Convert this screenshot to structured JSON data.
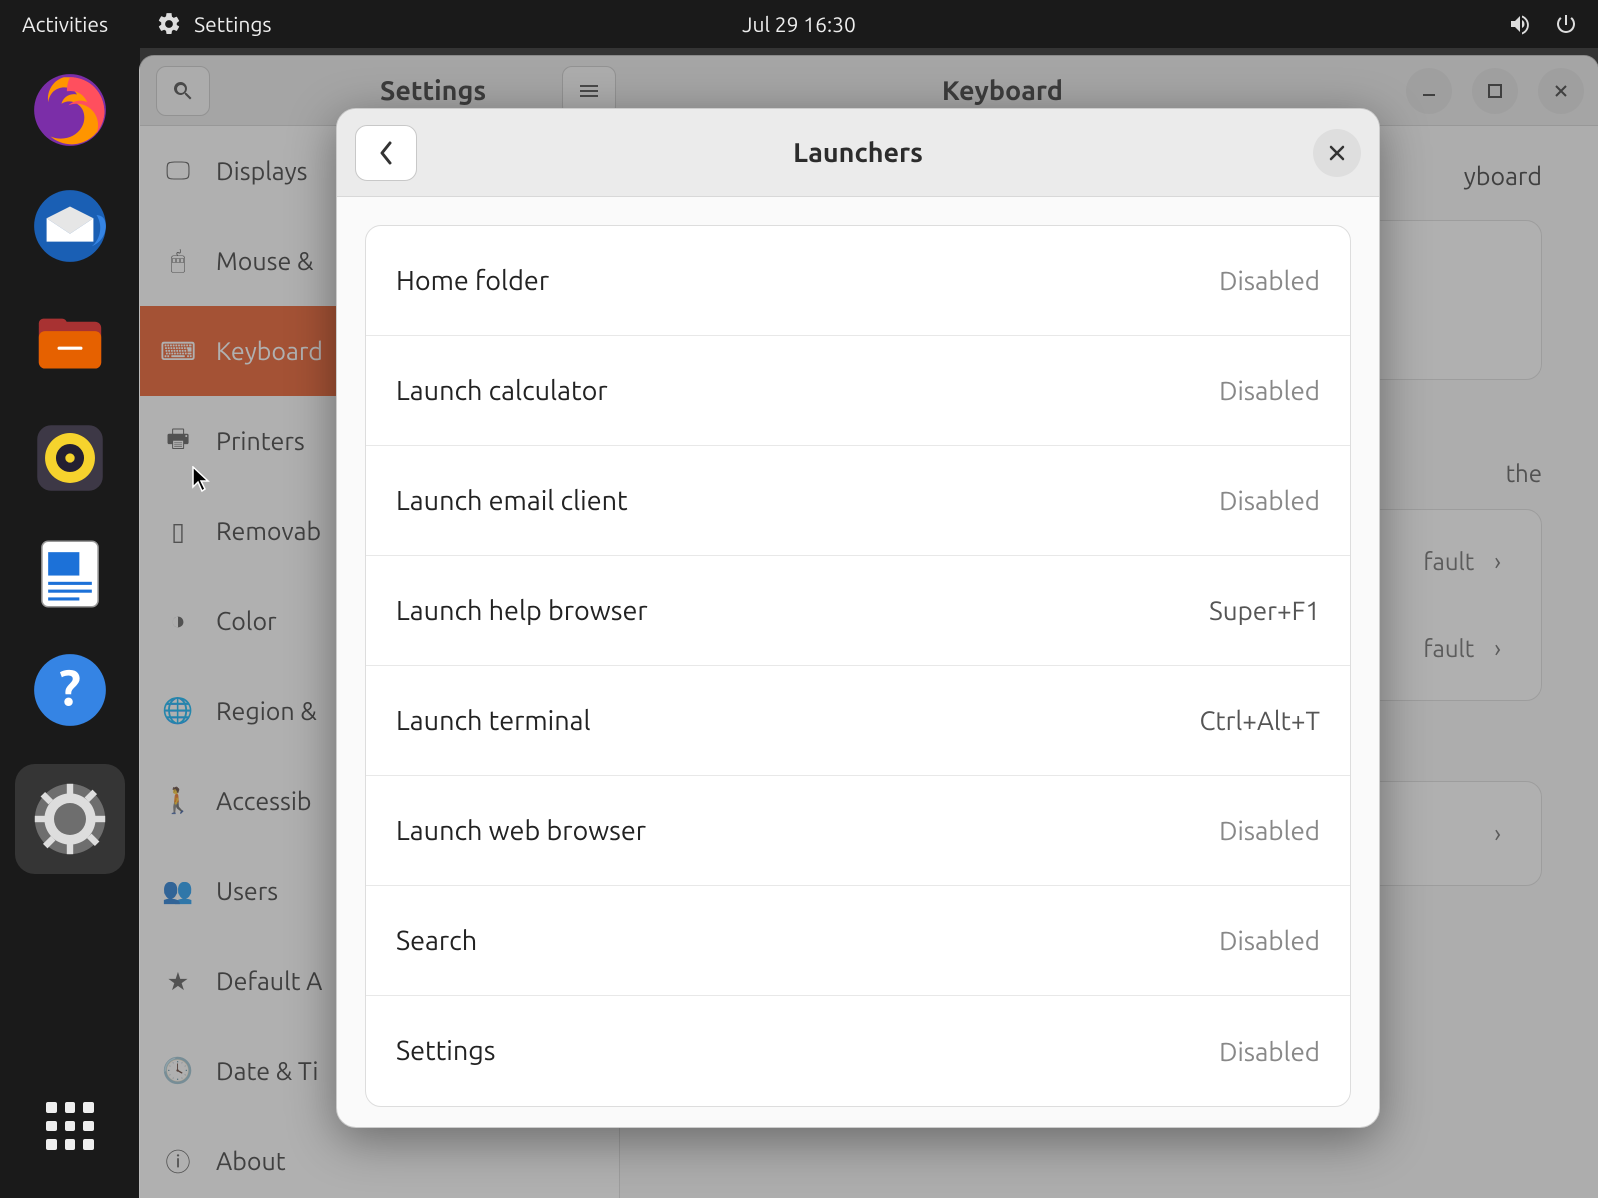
{
  "topbar": {
    "activities": "Activities",
    "app_name": "Settings",
    "clock": "Jul 29  16:30"
  },
  "window": {
    "title_left": "Settings",
    "title_center": "Keyboard"
  },
  "sidebar": {
    "items": [
      {
        "label": "Displays"
      },
      {
        "label": "Mouse &"
      },
      {
        "label": "Keyboard"
      },
      {
        "label": "Printers"
      },
      {
        "label": "Removab"
      },
      {
        "label": "Color"
      },
      {
        "label": "Region &"
      },
      {
        "label": "Accessib"
      },
      {
        "label": "Users"
      },
      {
        "label": "Default A"
      },
      {
        "label": "Date & Ti"
      },
      {
        "label": "About"
      }
    ]
  },
  "content": {
    "kb_partial_label": "yboard",
    "special_title": "",
    "special_desc_part": "the",
    "row1": {
      "label": "",
      "val": "fault"
    },
    "row2": {
      "label": "",
      "val": "fault"
    }
  },
  "dialog": {
    "title": "Launchers",
    "rows": [
      {
        "label": "Home folder",
        "shortcut": "Disabled"
      },
      {
        "label": "Launch calculator",
        "shortcut": "Disabled"
      },
      {
        "label": "Launch email client",
        "shortcut": "Disabled"
      },
      {
        "label": "Launch help browser",
        "shortcut": "Super+F1"
      },
      {
        "label": "Launch terminal",
        "shortcut": "Ctrl+Alt+T"
      },
      {
        "label": "Launch web browser",
        "shortcut": "Disabled"
      },
      {
        "label": "Search",
        "shortcut": "Disabled"
      },
      {
        "label": "Settings",
        "shortcut": "Disabled"
      }
    ]
  }
}
